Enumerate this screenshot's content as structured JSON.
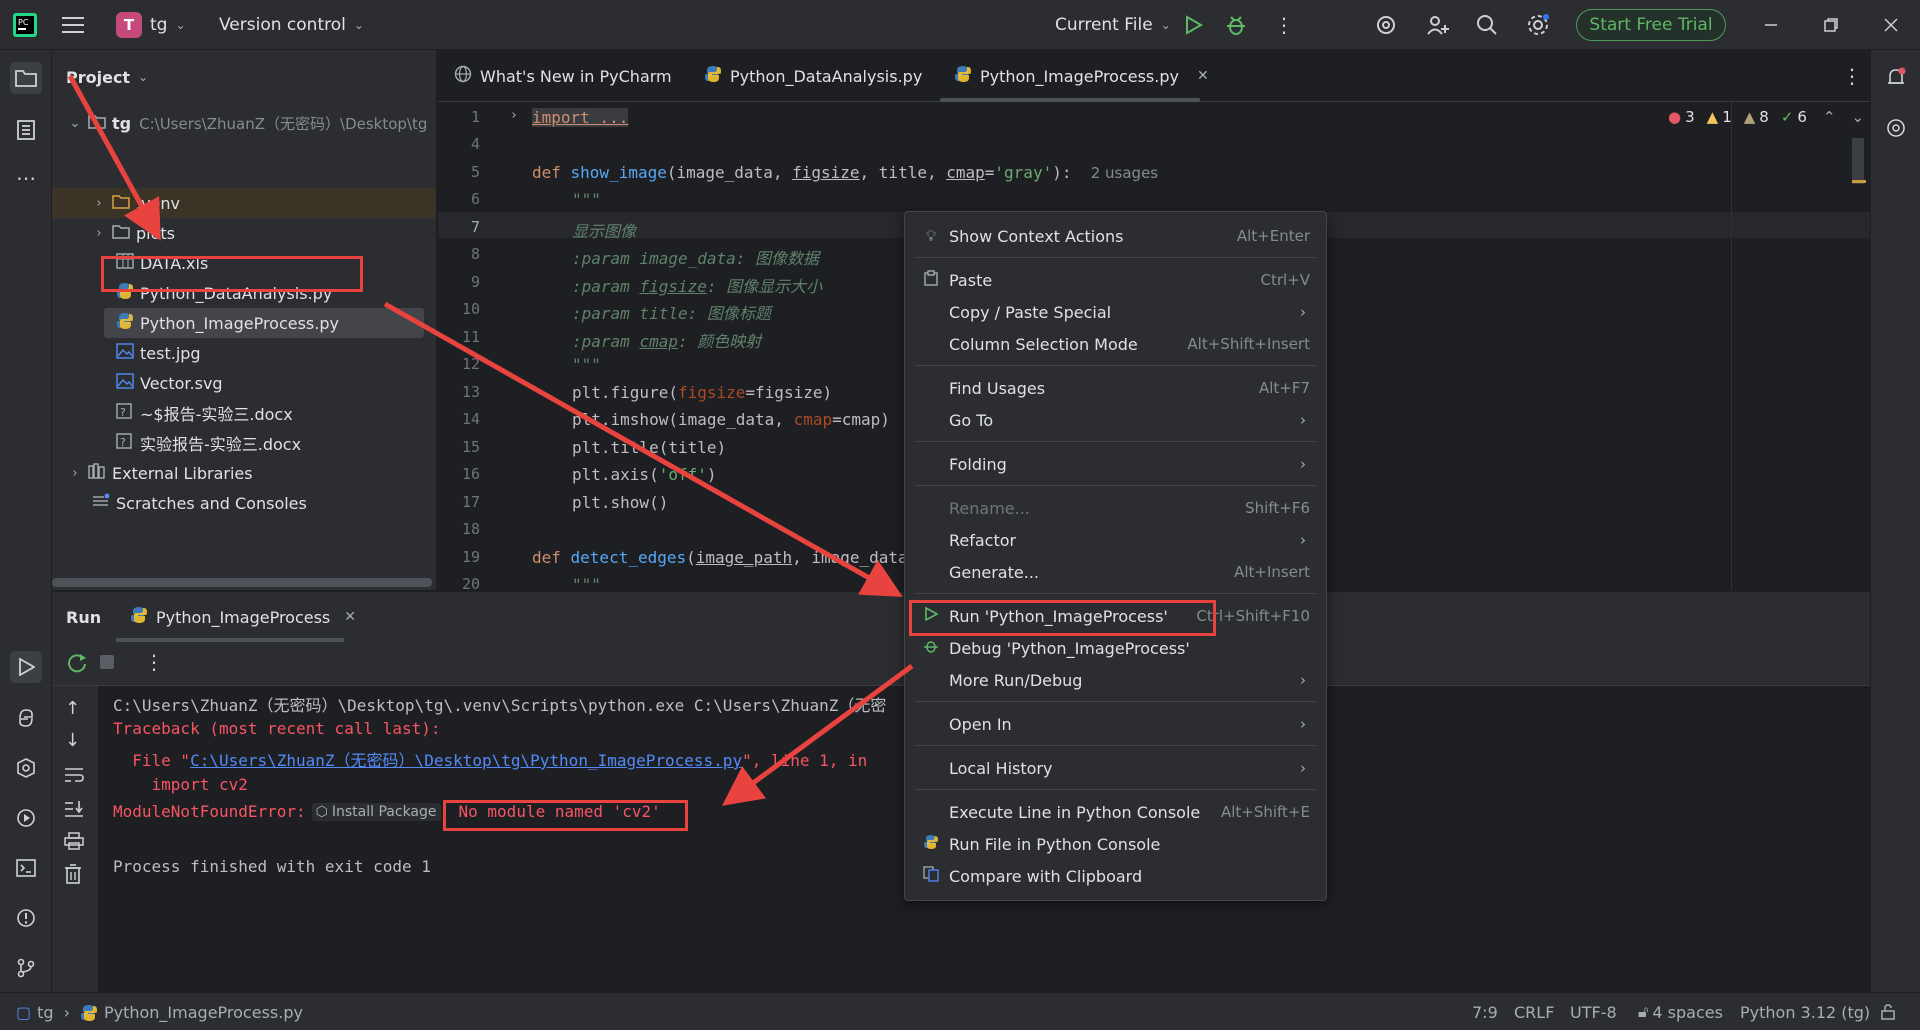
{
  "titlebar": {
    "project_initial": "T",
    "project_name": "tg",
    "vcs": "Version control",
    "run_config": "Current File",
    "trial_button": "Start Free Trial"
  },
  "project_panel": {
    "title": "Project",
    "root_name": "tg",
    "root_path": "C:\\Users\\ZhuanZ（无密码）\\Desktop\\tg",
    "items": [
      {
        "label": ".venv"
      },
      {
        "label": "plots"
      },
      {
        "label": "DATA.xls"
      },
      {
        "label": "Python_DataAnalysis.py"
      },
      {
        "label": "Python_ImageProcess.py"
      },
      {
        "label": "test.jpg"
      },
      {
        "label": "Vector.svg"
      },
      {
        "label": "~$报告-实验三.docx"
      },
      {
        "label": "实验报告-实验三.docx"
      },
      {
        "label": "External Libraries"
      },
      {
        "label": "Scratches and Consoles"
      }
    ]
  },
  "tabs": [
    {
      "label": "What's New in PyCharm"
    },
    {
      "label": "Python_DataAnalysis.py"
    },
    {
      "label": "Python_ImageProcess.py"
    }
  ],
  "inspections": {
    "errors": "3",
    "warnings": "1",
    "weak_warnings": "8",
    "ok": "6"
  },
  "editor": {
    "line_numbers": [
      "1",
      "4",
      "5",
      "6",
      "7",
      "8",
      "9",
      "10",
      "11",
      "12",
      "13",
      "14",
      "15",
      "16",
      "17",
      "18",
      "19",
      "20"
    ],
    "usages_hint": "2 usages"
  },
  "run_panel": {
    "title": "Run",
    "tab": "Python_ImageProcess",
    "output": {
      "cmd": "C:\\Users\\ZhuanZ（无密码）\\Desktop\\tg\\.venv\\Scripts\\python.exe C:\\Users\\ZhuanZ（无密",
      "traceback": "Traceback (most recent call last):",
      "file_prefix": "  File \"",
      "file_link": "C:\\Users\\ZhuanZ（无密码）\\Desktop\\tg\\Python_ImageProcess.py",
      "file_suffix": "\", line 1, in",
      "import_line": "    import cv2",
      "error_name": "ModuleNotFoundError:",
      "install_package": "Install Package",
      "error_msg": "No module named 'cv2'",
      "finished": "Process finished with exit code 1"
    }
  },
  "context_menu": {
    "items": [
      {
        "label": "Show Context Actions",
        "shortcut": "Alt+Enter"
      },
      {
        "label": "Paste",
        "shortcut": "Ctrl+V"
      },
      {
        "label": "Copy / Paste Special",
        "shortcut": ""
      },
      {
        "label": "Column Selection Mode",
        "shortcut": "Alt+Shift+Insert"
      },
      {
        "label": "Find Usages",
        "shortcut": "Alt+F7"
      },
      {
        "label": "Go To",
        "shortcut": ""
      },
      {
        "label": "Folding",
        "shortcut": ""
      },
      {
        "label": "Rename...",
        "shortcut": "Shift+F6"
      },
      {
        "label": "Refactor",
        "shortcut": ""
      },
      {
        "label": "Generate...",
        "shortcut": "Alt+Insert"
      },
      {
        "label": "Run 'Python_ImageProcess'",
        "shortcut": "Ctrl+Shift+F10"
      },
      {
        "label": "Debug 'Python_ImageProcess'",
        "shortcut": ""
      },
      {
        "label": "More Run/Debug",
        "shortcut": ""
      },
      {
        "label": "Open In",
        "shortcut": ""
      },
      {
        "label": "Local History",
        "shortcut": ""
      },
      {
        "label": "Execute Line in Python Console",
        "shortcut": "Alt+Shift+E"
      },
      {
        "label": "Run File in Python Console",
        "shortcut": ""
      },
      {
        "label": "Compare with Clipboard",
        "shortcut": ""
      }
    ]
  },
  "statusbar": {
    "project": "tg",
    "file": "Python_ImageProcess.py",
    "position": "7:9",
    "line_sep": "CRLF",
    "encoding": "UTF-8",
    "indent": "4 spaces",
    "interpreter": "Python 3.12 (tg)"
  },
  "colors": {
    "accent_red": "#e8433f",
    "run_green": "#5fb865",
    "error_text": "#f75464"
  }
}
